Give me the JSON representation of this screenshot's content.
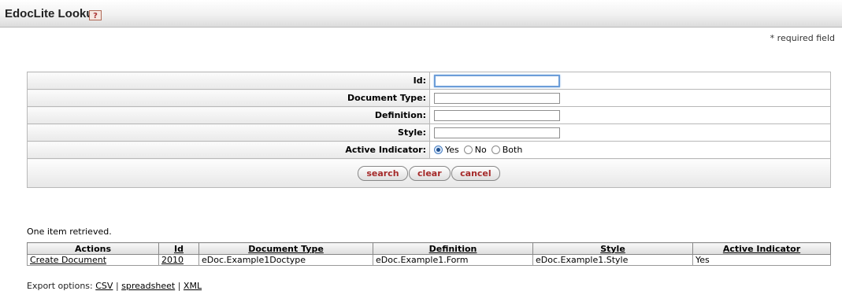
{
  "header": {
    "title": "EdocLite Lookup",
    "help_glyph": "?"
  },
  "required_note": "* required field",
  "form": {
    "fields": [
      {
        "label": "Id:",
        "value": ""
      },
      {
        "label": "Document Type:",
        "value": ""
      },
      {
        "label": "Definition:",
        "value": ""
      },
      {
        "label": "Style:",
        "value": ""
      }
    ],
    "active_indicator": {
      "label": "Active Indicator:",
      "options": [
        "Yes",
        "No",
        "Both"
      ],
      "selected": "Yes"
    },
    "buttons": {
      "search": "search",
      "clear": "clear",
      "cancel": "cancel"
    }
  },
  "results": {
    "count_text": "One item retrieved.",
    "columns": [
      "Actions",
      "Id",
      "Document Type",
      "Definition",
      "Style",
      "Active Indicator"
    ],
    "rows": [
      [
        "Create Document",
        "2010",
        "eDoc.Example1Doctype",
        "eDoc.Example1.Form",
        "eDoc.Example1.Style",
        "Yes"
      ]
    ]
  },
  "export": {
    "label": "Export options:",
    "csv": "CSV",
    "spreadsheet": "spreadsheet",
    "xml": "XML",
    "sep": "|"
  },
  "colors": {
    "button_text": "#a52a2a",
    "focus_border": "#6c9dd8"
  }
}
